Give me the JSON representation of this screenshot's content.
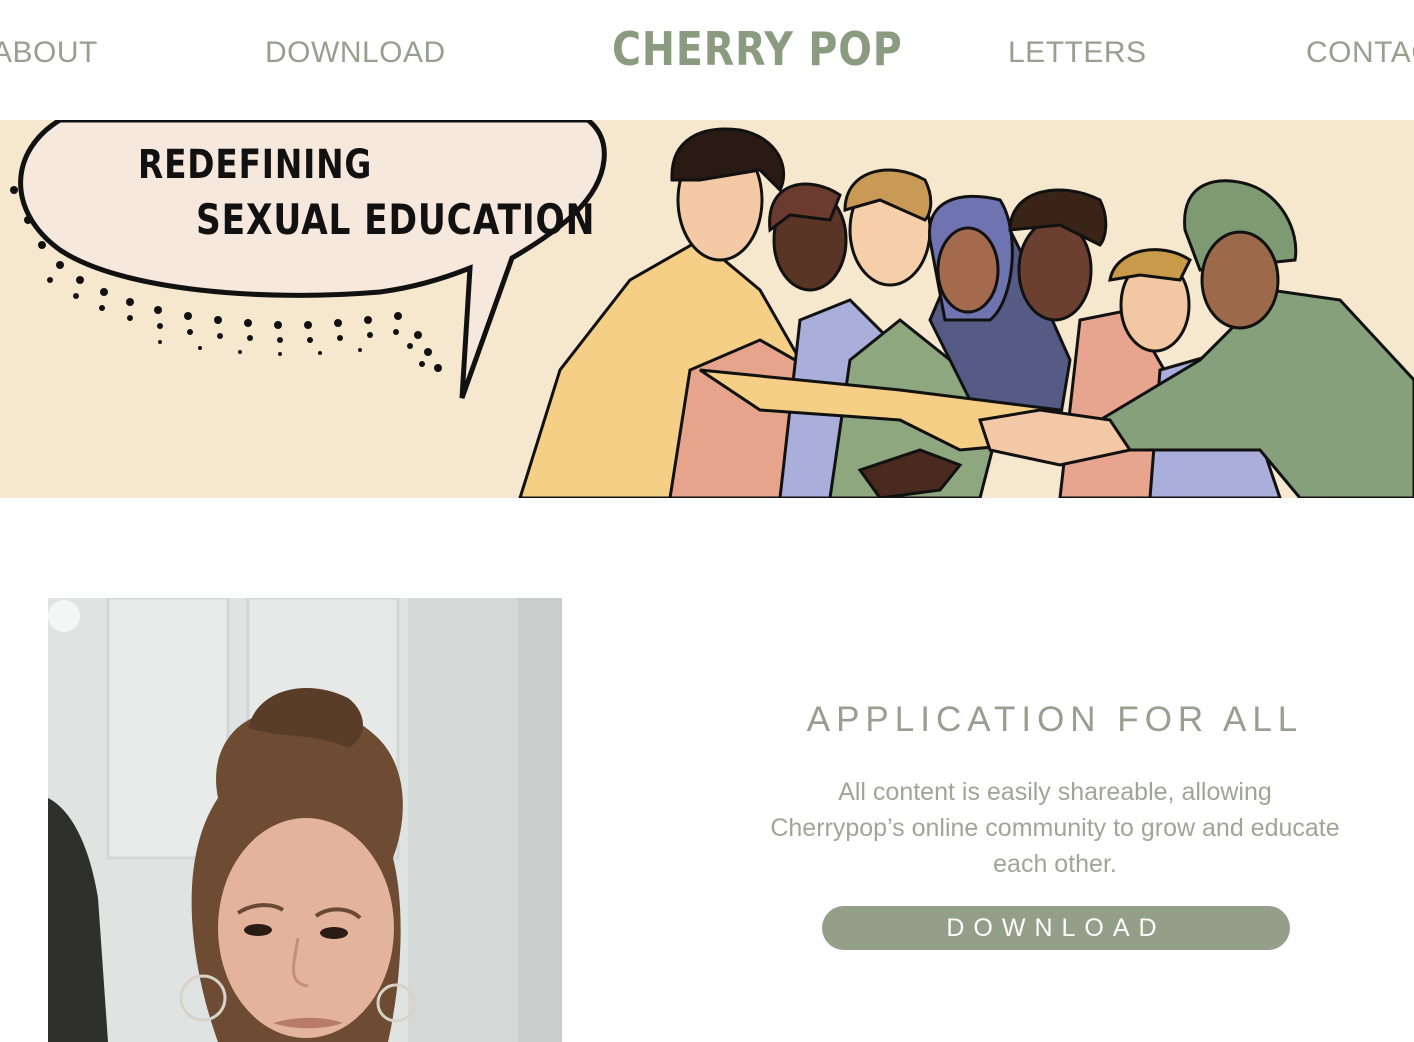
{
  "nav": {
    "about": "ABOUT",
    "download": "DOWNLOAD",
    "logo": "CHERRY POP",
    "letters": "LETTERS",
    "contact": "CONTACT"
  },
  "hero": {
    "line1": "REDEFINING",
    "line2": "SEXUAL EDUCATION"
  },
  "section": {
    "title": "APPLICATION FOR ALL",
    "body": "All content is easily shareable, allowing Cherrypop’s online community to grow and educate each other.",
    "button": "DOWNLOAD"
  },
  "colors": {
    "accent": "#949f89",
    "text_muted": "#97a08f",
    "hero_bg": "#f6e8cf"
  }
}
